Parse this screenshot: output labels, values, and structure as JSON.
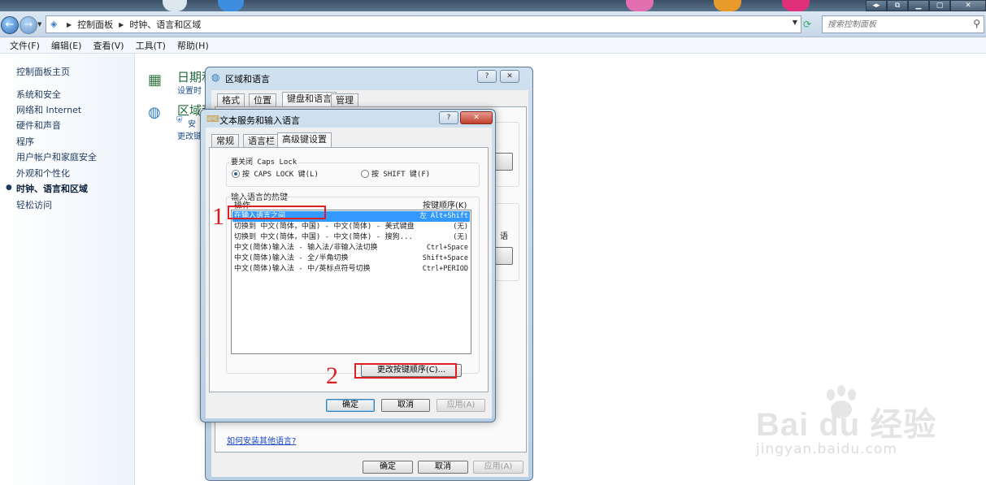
{
  "explorer": {
    "breadcrumbs": [
      "控制面板",
      "时钟、语言和区域"
    ],
    "search_placeholder": "搜索控制面板",
    "menu": [
      "文件(F)",
      "编辑(E)",
      "查看(V)",
      "工具(T)",
      "帮助(H)"
    ]
  },
  "sidebar": {
    "home": "控制面板主页",
    "items": [
      "系统和安全",
      "网络和 Internet",
      "硬件和声音",
      "程序",
      "用户帐户和家庭安全",
      "外观和个性化",
      "时钟、语言和区域",
      "轻松访问"
    ],
    "active_index": 6
  },
  "main": {
    "cat1_title": "日期和",
    "cat1_sub": "设置时",
    "cat2_title": "区域和",
    "cat2_sub1": "安",
    "cat2_sub2": "更改键"
  },
  "region_dialog": {
    "title": "区域和语言",
    "tabs": [
      "格式",
      "位置",
      "键盘和语言",
      "管理"
    ],
    "active_tab": 2,
    "side_text": "语",
    "link": "如何安装其他语言?",
    "ok": "确定",
    "cancel": "取消",
    "apply": "应用(A)"
  },
  "text_services_dialog": {
    "title": "文本服务和输入语言",
    "tabs": [
      "常规",
      "语言栏",
      "高级键设置"
    ],
    "active_tab": 2,
    "caps_group": "要关闭 Caps Lock",
    "caps_option1": "按 CAPS LOCK 键(L)",
    "caps_option2": "按 SHIFT 键(F)",
    "hotkey_group": "输入语言的热键",
    "col_action": "操作",
    "col_keys": "按键顺序(K)",
    "rows": [
      {
        "action": "在输入语言之间",
        "keys": "左 Alt+Shift"
      },
      {
        "action": "切换到 中文(简体，中国) - 中文(简体) - 美式键盘",
        "keys": "(无)"
      },
      {
        "action": "切换到 中文(简体，中国) - 中文(简体) - 搜狗...",
        "keys": "(无)"
      },
      {
        "action": "中文(简体)输入法 - 输入法/非输入法切换",
        "keys": "Ctrl+Space"
      },
      {
        "action": "中文(简体)输入法 - 全/半角切换",
        "keys": "Shift+Space"
      },
      {
        "action": "中文(简体)输入法 - 中/英标点符号切换",
        "keys": "Ctrl+PERIOD"
      }
    ],
    "selected_row": 0,
    "change_key_btn": "更改按键顺序(C)...",
    "ok": "确定",
    "cancel": "取消",
    "apply": "应用(A)"
  },
  "annotations": {
    "one": "1",
    "two": "2"
  },
  "watermark": {
    "logo": "Bai du 经验",
    "url": "jingyan.baidu.com"
  }
}
